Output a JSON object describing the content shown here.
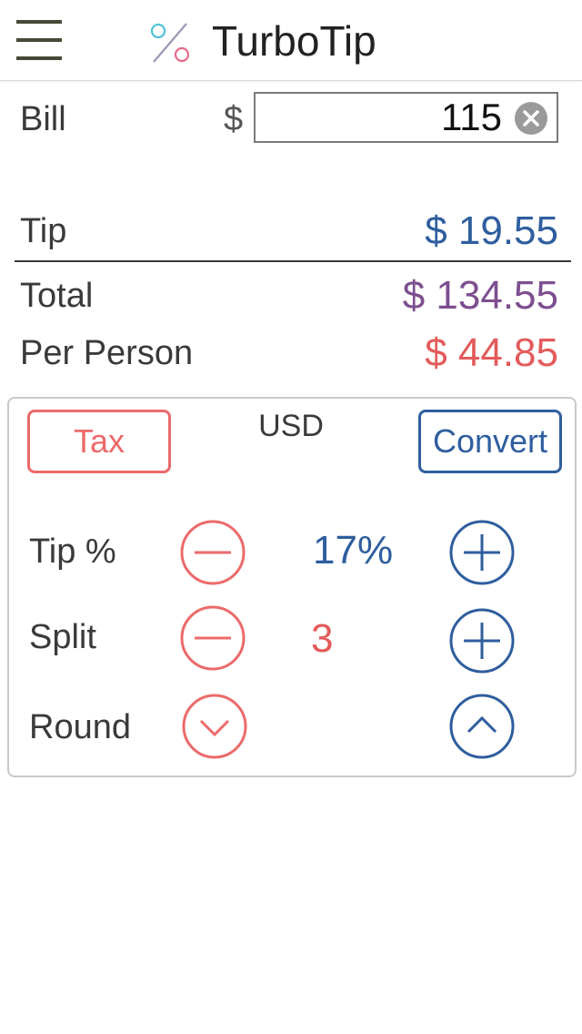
{
  "header": {
    "title": "TurboTip",
    "menu_icon": "hamburger-menu-icon",
    "logo_icon": "percent-logo-icon"
  },
  "bill": {
    "label": "Bill",
    "currency_symbol": "$",
    "value": "115",
    "clear_icon": "clear-icon"
  },
  "summary": {
    "tip_label": "Tip",
    "tip_value": "$ 19.55",
    "total_label": "Total",
    "total_value": "$ 134.55",
    "per_person_label": "Per Person",
    "per_person_value": "$ 44.85"
  },
  "controls": {
    "tax_label": "Tax",
    "currency_code": "USD",
    "convert_label": "Convert",
    "tip_percent_label": "Tip %",
    "tip_percent_value": "17%",
    "split_label": "Split",
    "split_value": "3",
    "round_label": "Round"
  },
  "colors": {
    "blue": "#2f5e9e",
    "purple": "#7d4f8f",
    "red": "#e35b5b",
    "coral": "#ec6a6a"
  }
}
